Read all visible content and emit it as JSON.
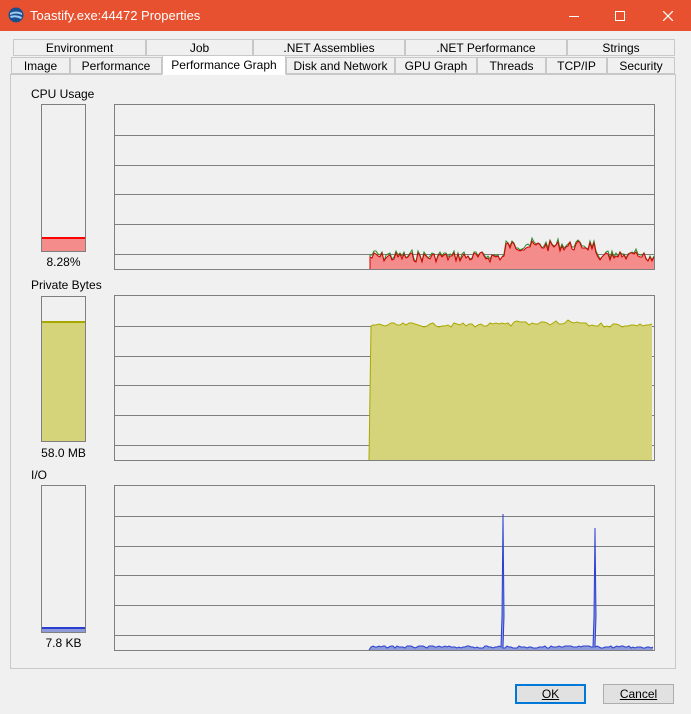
{
  "window": {
    "title": "Toastify.exe:44472 Properties",
    "colors": {
      "titlebar": "#e8512f",
      "cpu": "#ff0000",
      "cpu_fill": "#f58c8c",
      "private_fill": "#d6d47a",
      "private_line": "#a8a800",
      "io": "#2a3fd1",
      "io_fill": "#8f9ad9"
    }
  },
  "tabs_row1": [
    "Environment",
    "Job",
    ".NET Assemblies",
    ".NET Performance",
    "Strings"
  ],
  "tabs_row2": [
    "Image",
    "Performance",
    "Performance Graph",
    "Disk and Network",
    "GPU Graph",
    "Threads",
    "TCP/IP",
    "Security"
  ],
  "active_tab": "Performance Graph",
  "sections": {
    "cpu": {
      "label": "CPU Usage",
      "value": "8.28%",
      "meter_level": 0.0828
    },
    "private": {
      "label": "Private Bytes",
      "value": "58.0 MB",
      "meter_level": 0.82
    },
    "io": {
      "label": "I/O",
      "value": "7.8  KB",
      "meter_level": 0.02
    }
  },
  "buttons": {
    "ok": "OK",
    "cancel": "Cancel"
  },
  "icons": [
    "app-icon",
    "minimize-icon",
    "maximize-icon",
    "close-icon"
  ]
}
